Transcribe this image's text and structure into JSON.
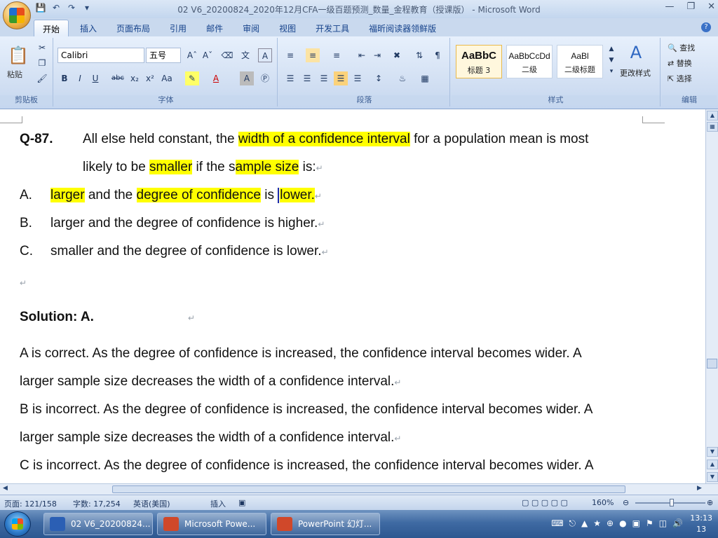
{
  "window": {
    "title": "02 V6_20200824_2020年12月CFA一级百题预测_数量_金程教育（授课版） - Microsoft Word"
  },
  "tabs": [
    "开始",
    "插入",
    "页面布局",
    "引用",
    "邮件",
    "审阅",
    "视图",
    "开发工具",
    "福昕阅读器领鲜版"
  ],
  "ribbon": {
    "clipboard": {
      "paste": "粘贴",
      "label": "剪贴板"
    },
    "font": {
      "name": "Calibri",
      "size": "五号",
      "label": "字体"
    },
    "paragraph": {
      "label": "段落"
    },
    "styles": {
      "items": [
        {
          "preview": "AaBbC",
          "name": "标题 3"
        },
        {
          "preview": "AaBbCcDd",
          "name": "二级"
        },
        {
          "preview": "AaBl",
          "name": "二级标题"
        }
      ],
      "change": "更改样式",
      "label": "样式"
    },
    "editing": {
      "find": "查找",
      "replace": "替换",
      "select": "选择",
      "label": "编辑"
    }
  },
  "document": {
    "q_label": "Q-87.",
    "q_line1_a": "All else held constant, the ",
    "q_line1_hl": "width of a confidence interval",
    "q_line1_b": " for a population mean is most",
    "q_line2_a": "likely to be ",
    "q_line2_hl1": "smaller",
    "q_line2_b": " if the s",
    "q_line2_hl2": "ample size",
    "q_line2_c": " is:",
    "optA_label": "A.",
    "optA_hl1": "larger",
    "optA_a": " and the ",
    "optA_hl2": "degree of confidence",
    "optA_b": " is ",
    "optA_hl3": "lower.",
    "optB_label": "B.",
    "optB_text": "larger and the degree of confidence is higher.",
    "optC_label": "C.",
    "optC_text": "smaller and the degree of confidence is lower.",
    "solution": "Solution: A.",
    "sol_line1": "A is correct. As the degree of confidence is increased, the confidence interval becomes wider. A",
    "sol_line2": "larger sample size decreases the width of a confidence interval.",
    "sol_line3": "B is incorrect. As the degree of confidence is increased, the confidence interval becomes wider. A",
    "sol_line4": "larger sample size decreases the width of a confidence interval.",
    "sol_line5": "C is incorrect. As the degree of confidence is increased, the confidence interval becomes wider. A"
  },
  "status": {
    "page": "页面: 121/158",
    "words": "字数: 17,254",
    "lang": "英语(美国)",
    "mode": "插入",
    "zoom": "160%"
  },
  "taskbar": {
    "items": [
      "02 V6_20200824...",
      "Microsoft Powe...",
      "PowerPoint 幻灯..."
    ],
    "time": "13:13",
    "date": "13"
  }
}
